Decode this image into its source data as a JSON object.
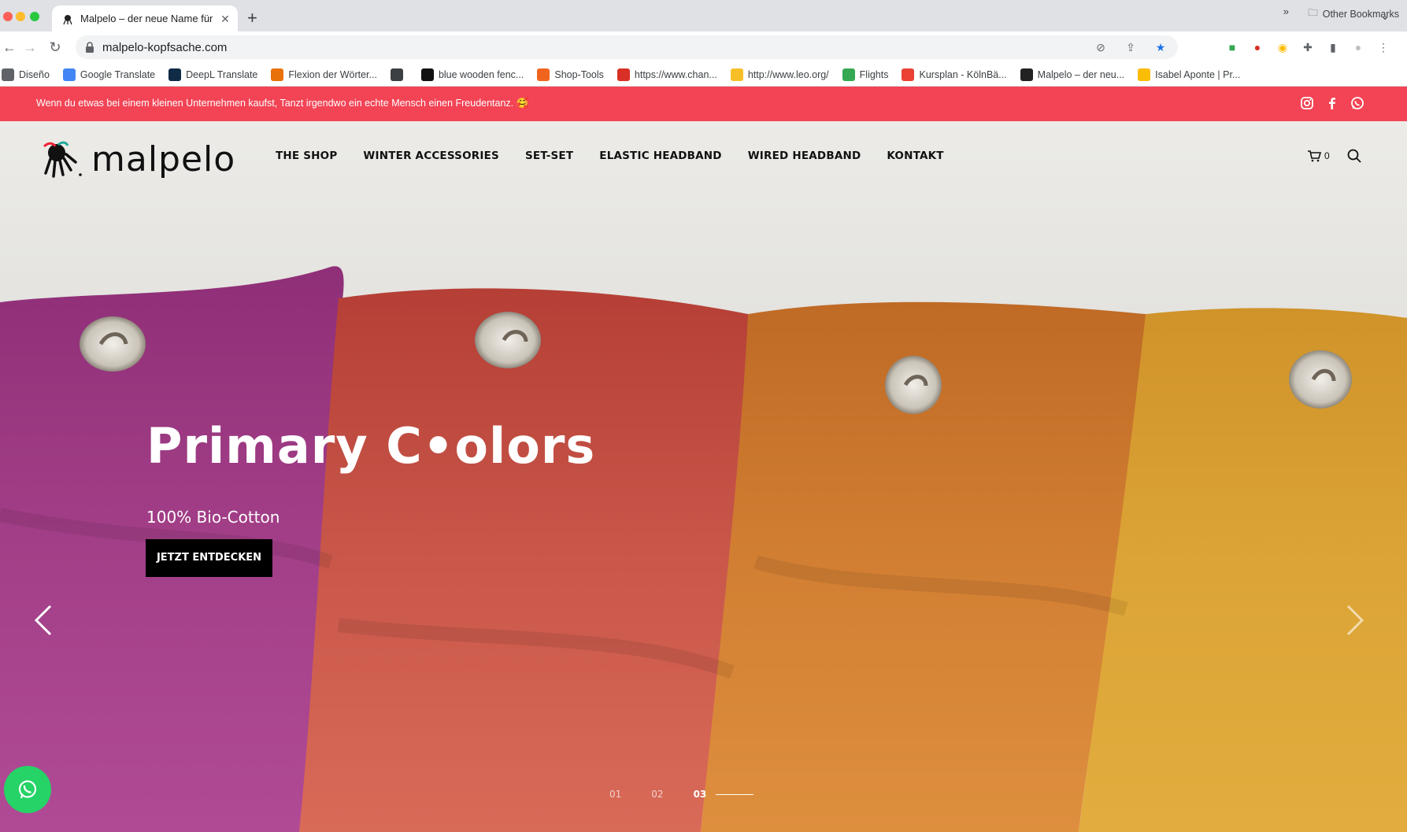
{
  "browser": {
    "tab_title": "Malpelo – der neue Name für b",
    "url": "malpelo-kopfsache.com",
    "bookmarks": [
      {
        "label": "Diseño",
        "color": "#5f6368"
      },
      {
        "label": "Google Translate",
        "color": "#4285f4"
      },
      {
        "label": "DeepL Translate",
        "color": "#0f2b46"
      },
      {
        "label": "Flexion der Wörter...",
        "color": "#e8710a"
      },
      {
        "label": "",
        "color": "#3c4043"
      },
      {
        "label": "blue wooden fenc...",
        "color": "#111111"
      },
      {
        "label": "Shop-Tools",
        "color": "#f1641e"
      },
      {
        "label": "https://www.chan...",
        "color": "#d93025"
      },
      {
        "label": "http://www.leo.org/",
        "color": "#f6bf26"
      },
      {
        "label": "Flights",
        "color": "#34a853"
      },
      {
        "label": "Kursplan - KölnBä...",
        "color": "#ea4335"
      },
      {
        "label": "Malpelo – der neu...",
        "color": "#222222"
      },
      {
        "label": "Isabel Aponte | Pr...",
        "color": "#fbbc04"
      }
    ],
    "more_label": "»",
    "other_bookmarks": "Other Bookmarks"
  },
  "announcement": {
    "text": "Wenn du etwas bei einem kleinen Unternehmen kaufst, Tanzt irgendwo ein echte Mensch einen Freudentanz. 🥰",
    "socials": [
      "instagram-icon",
      "facebook-icon",
      "whatsapp-icon"
    ]
  },
  "header": {
    "logo_text": "malpelo",
    "nav": [
      "THE SHOP",
      "WINTER ACCESSORIES",
      "SET-SET",
      "ELASTIC HEADBAND",
      "WIRED HEADBAND",
      "KONTAKT"
    ],
    "cart_count": "0"
  },
  "slider": {
    "title": "Primary C•olors",
    "subtitle": "100% Bio-Cotton",
    "cta": "JETZT ENTDECKEN",
    "pages": [
      "01",
      "02",
      "03"
    ],
    "active_page": "03"
  },
  "colors": {
    "announcement_bg": "#f24455",
    "purple": "#a43d8a",
    "red": "#c94b3f",
    "orange": "#d27a2c",
    "yellow": "#dba233",
    "whatsapp": "#25d366"
  }
}
